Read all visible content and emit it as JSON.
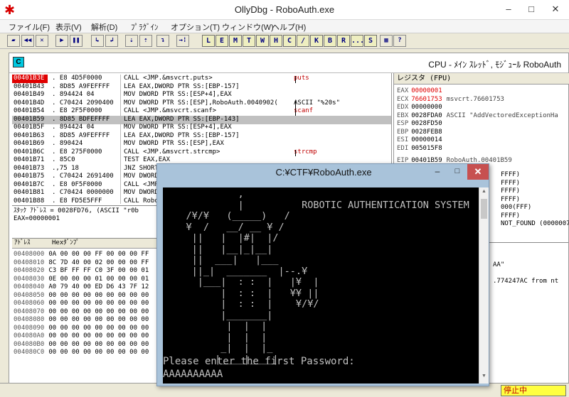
{
  "window": {
    "title": "OllyDbg - RoboAuth.exe",
    "minimize_glyph": "–",
    "maximize_glyph": "□",
    "close_glyph": "✕",
    "app_icon_glyph": "✱"
  },
  "menu": [
    "ファイル(F)",
    "表示(V)",
    "解析(D)",
    "ﾌﾟﾗｸﾞｲﾝ",
    "オプション(T)",
    "ウィンドウ(W)",
    "ヘルプ(H)"
  ],
  "toolbar": {
    "buttons": [
      "▰",
      "◀◀",
      "✕",
      "▶",
      "❚❚",
      "↳",
      "↲",
      "⇣",
      "⇡",
      "↴",
      "→⁞"
    ],
    "letters": [
      "L",
      "E",
      "M",
      "T",
      "W",
      "H",
      "C",
      "/",
      "K",
      "B",
      "R",
      "...",
      "S",
      "▦",
      "?"
    ]
  },
  "cpu": {
    "icon": "C",
    "title": "CPU - ﾒｲﾝ ｽﾚｯﾄﾞ, ﾓｼﾞｭｰﾙ RoboAuth"
  },
  "disasm": [
    {
      "addr": "00401B3E",
      "hex": ". E8 4D5F0000",
      "asm": "CALL <JMP.&msvcrt.puts>",
      "com": "puts",
      "bp": true
    },
    {
      "addr": "00401B43",
      "hex": ". 8D85 A9FEFFFF",
      "asm": "LEA EAX,DWORD PTR SS:[EBP-157]",
      "com": ""
    },
    {
      "addr": "00401B49",
      "hex": ". 894424 04",
      "asm": "MOV DWORD PTR SS:[ESP+4],EAX",
      "com": ""
    },
    {
      "addr": "00401B4D",
      "hex": ". C70424 2090400",
      "asm": "MOV DWORD PTR SS:[ESP],RoboAuth.0040902(",
      "com": "ASCII \"%20s\""
    },
    {
      "addr": "00401B54",
      "hex": ". E8 2F5F0000",
      "asm": "CALL <JMP.&msvcrt.scanf>",
      "com": "scanf"
    },
    {
      "addr": "00401B59",
      "hex": ". 8D85 BDFEFFFF",
      "asm": "LEA EAX,DWORD PTR SS:[EBP-143]",
      "com": "",
      "sel": true
    },
    {
      "addr": "00401B5F",
      "hex": ". 894424 04",
      "asm": "MOV DWORD PTR SS:[ESP+4],EAX",
      "com": ""
    },
    {
      "addr": "00401B63",
      "hex": ". 8D85 A9FEFFFF",
      "asm": "LEA EAX,DWORD PTR SS:[EBP-157]",
      "com": ""
    },
    {
      "addr": "00401B69",
      "hex": ". 890424",
      "asm": "MOV DWORD PTR SS:[ESP],EAX",
      "com": ""
    },
    {
      "addr": "00401B6C",
      "hex": ". E8 275F0000",
      "asm": "CALL <JMP.&msvcrt.strcmp>",
      "com": "strcmp"
    },
    {
      "addr": "00401B71",
      "hex": ". 85C0",
      "asm": "TEST EAX,EAX",
      "com": ""
    },
    {
      "addr": "00401B73",
      "hex": ".,75 18",
      "asm": "JNZ SHORT",
      "com": ""
    },
    {
      "addr": "00401B75",
      "hex": ". C70424 2691400",
      "asm": "MOV DWORD",
      "com": ""
    },
    {
      "addr": "00401B7C",
      "hex": ". E8 0F5F0000",
      "asm": "CALL <JMP",
      "com": ""
    },
    {
      "addr": "00401B81",
      "hex": ". C70424 0000000",
      "asm": "MOV DWORD",
      "com": ""
    },
    {
      "addr": "00401B88",
      "hex": ". E8 FD5E5FFF",
      "asm": "CALL Robo",
      "com": ""
    }
  ],
  "info": {
    "line1": "ｽﾀｯｸ ｱﾄﾞﾚｽ = 0028FD76, (ASCII \"r0b",
    "line2": "EAX=00000001"
  },
  "registers": {
    "header": "レジスタ (FPU)",
    "rows": [
      {
        "name": "EAX",
        "value": "00000001",
        "note": "",
        "red": true
      },
      {
        "name": "ECX",
        "value": "76601753",
        "note": "msvcrt.76601753",
        "red": true
      },
      {
        "name": "EDX",
        "value": "00000000",
        "note": ""
      },
      {
        "name": "EBX",
        "value": "0028FDA0",
        "note": "ASCII \"AddVectoredExceptionHa"
      },
      {
        "name": "ESP",
        "value": "0028FD50",
        "note": ""
      },
      {
        "name": "EBP",
        "value": "0028FEB8",
        "note": ""
      },
      {
        "name": "ESI",
        "value": "00000014",
        "note": ""
      },
      {
        "name": "EDI",
        "value": "005015F8",
        "note": ""
      },
      {
        "name": "EIP",
        "value": "00401B59",
        "note": "RoboAuth.00401B59"
      }
    ],
    "partial": [
      "FFFF)",
      "FFFF)",
      "FFFF)",
      "FFFF)",
      "000(FFF)",
      "FFFF)",
      "NOT_FOUND (0000007"
    ]
  },
  "dump": {
    "header_addr": "ｱﾄﾞﾚｽ",
    "header_hex": "Hexﾀﾞﾝﾌﾟ",
    "rows": [
      {
        "addr": "00408000",
        "hex": "0A 00 00 00 FF 00 00 00 FF"
      },
      {
        "addr": "00408010",
        "hex": "8C 7D 40 00 02 00 00 00 FF"
      },
      {
        "addr": "00408020",
        "hex": "C3 BF FF FF C0 3F 00 00 01"
      },
      {
        "addr": "00408030",
        "hex": "0E 00 00 00 01 00 00 00 01"
      },
      {
        "addr": "00408040",
        "hex": "A0 79 40 00 ED D6 43 7F 12"
      },
      {
        "addr": "00408050",
        "hex": "00 00 00 00 00 00 00 00 00"
      },
      {
        "addr": "00408060",
        "hex": "00 00 00 00 00 00 00 00 00"
      },
      {
        "addr": "00408070",
        "hex": "00 00 00 00 00 00 00 00 00"
      },
      {
        "addr": "00408080",
        "hex": "00 00 00 00 00 00 00 00 00"
      },
      {
        "addr": "00408090",
        "hex": "00 00 00 00 00 00 00 00 00"
      },
      {
        "addr": "004080A0",
        "hex": "00 00 00 00 00 00 00 00 00"
      },
      {
        "addr": "004080B0",
        "hex": "00 00 00 00 00 00 00 00 00"
      },
      {
        "addr": "004080C0",
        "hex": "00 00 00 00 00 00 00 00 00"
      }
    ]
  },
  "stack": {
    "rows": [
      "AA\"",
      ".774247AC from nt"
    ]
  },
  "status": {
    "text": "停止中"
  },
  "console": {
    "title": "C:¥CTF¥RoboAuth.exe",
    "min_glyph": "–",
    "max_glyph": "□",
    "close_glyph": "✕",
    "art": "             ,\n             |          ROBOTIC AUTHENTICATION SYSTEM\n    /¥/¥   (_____)   /\n    ¥  /   __/ __ ¥ /\n     ||   |  |#|  |/\n     ||   |__|_|__|\n     ||  ___|   |___\n     ||_|  _______  |--.¥\n      |___|  : :  |   |¥  |\n          |  : :  |   ¥¥ ||\n          |  : :  |    ¥/¥/\n          |_______|\n           |  |  |\n           |  |  |\n          _|  |  |_\n         |____|____|",
    "prompt": "Please enter the first Password:",
    "input": "AAAAAAAAAA"
  }
}
